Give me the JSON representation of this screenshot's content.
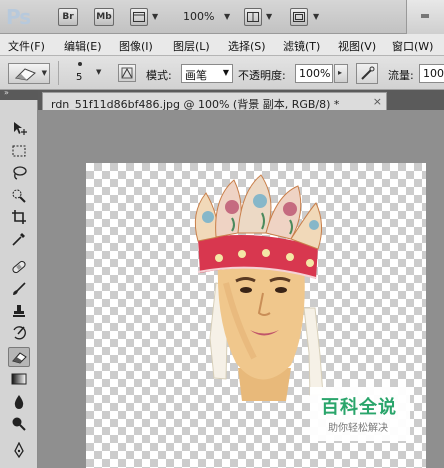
{
  "app": {
    "logo": "Ps",
    "bridge_label": "Br",
    "minibridge_label": "Mb",
    "zoom": "100%"
  },
  "menu": [
    "文件(F)",
    "编辑(E)",
    "图像(I)",
    "图层(L)",
    "选择(S)",
    "滤镜(T)",
    "视图(V)",
    "窗口(W)"
  ],
  "options": {
    "brush_size": "5",
    "mode_label": "模式:",
    "mode_value": "画笔",
    "opacity_label": "不透明度:",
    "opacity_value": "100%",
    "flow_label": "流量:",
    "flow_value": "100"
  },
  "document": {
    "tab_title": "rdn_51f11d86bf486.jpg @ 100% (背景 副本, RGB/8) *",
    "close_glyph": "×"
  },
  "tools": [
    {
      "name": "move-tool",
      "icon": "move-icon"
    },
    {
      "name": "marquee-tool",
      "icon": "marquee-icon"
    },
    {
      "name": "lasso-tool",
      "icon": "lasso-icon"
    },
    {
      "name": "quick-select-tool",
      "icon": "quick-select-icon"
    },
    {
      "name": "crop-tool",
      "icon": "crop-icon"
    },
    {
      "name": "eyedropper-tool",
      "icon": "eyedropper-icon"
    },
    {
      "name": "healing-tool",
      "icon": "bandage-icon"
    },
    {
      "name": "brush-tool",
      "icon": "brush-icon"
    },
    {
      "name": "clone-stamp-tool",
      "icon": "stamp-icon"
    },
    {
      "name": "history-brush-tool",
      "icon": "history-brush-icon"
    },
    {
      "name": "eraser-tool",
      "icon": "eraser-icon",
      "active": true
    },
    {
      "name": "gradient-tool",
      "icon": "gradient-icon"
    },
    {
      "name": "blur-tool",
      "icon": "blur-drop-icon"
    },
    {
      "name": "dodge-tool",
      "icon": "dodge-icon"
    },
    {
      "name": "pen-tool",
      "icon": "pen-icon"
    }
  ],
  "watermark": {
    "title": "百科全说",
    "subtitle": "助你轻松解决"
  },
  "colors": {
    "accent_green": "#2aa56b",
    "hat_red": "#d8374f"
  }
}
